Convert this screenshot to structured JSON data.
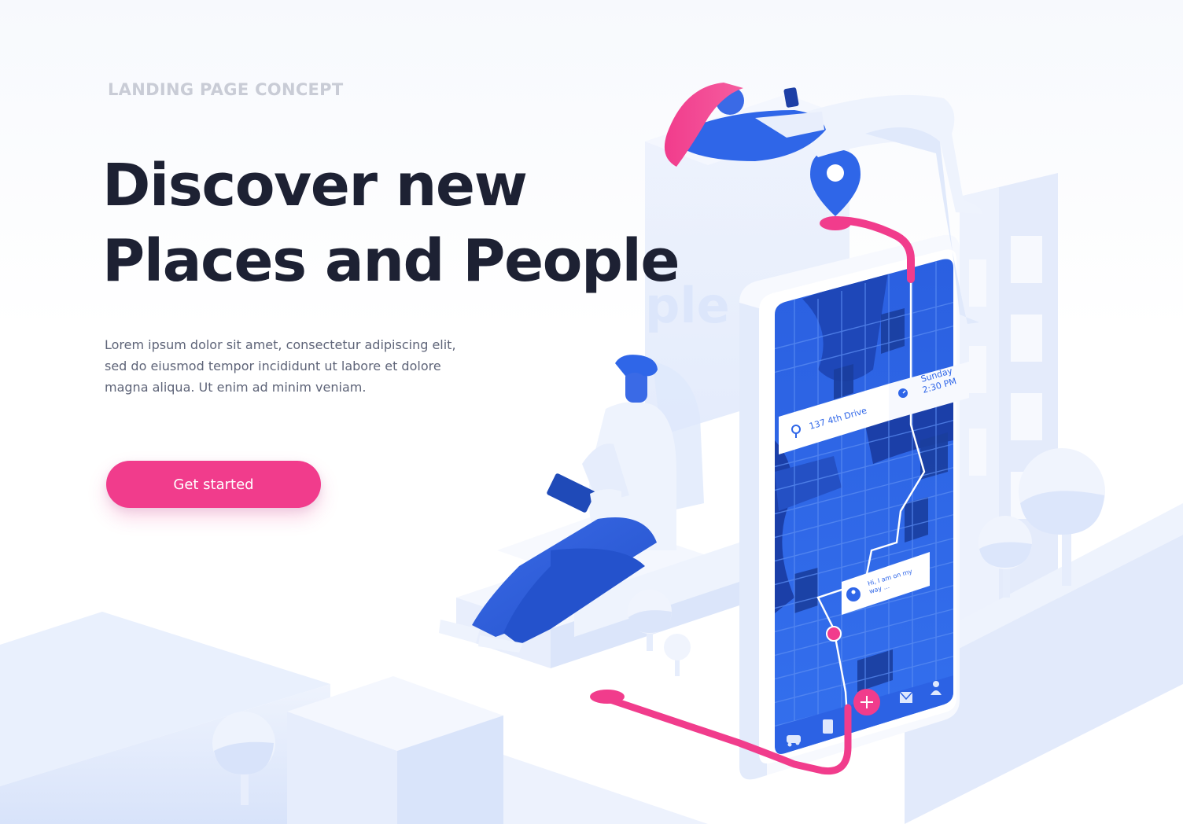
{
  "hero": {
    "eyebrow": "LANDING PAGE CONCEPT",
    "headline_line1": "Discover new",
    "headline_line2": "Places and People",
    "body_line1": "Lorem ipsum dolor sit amet, consectetur adipiscing elit,",
    "body_line2": "sed do eiusmod tempor incididunt ut labore et dolore",
    "body_line3": "magna aliqua. Ut enim ad minim veniam.",
    "cta_label": "Get started"
  },
  "phone": {
    "address": "137 4th Drive",
    "day": "Sunday",
    "time": "2:30 PM",
    "message_line1": "Hi, I am on my",
    "message_line2": "way ...",
    "nav_icons": [
      "car-icon",
      "bus-icon",
      "plus-icon",
      "mail-icon",
      "user-icon"
    ]
  },
  "building_text": "ple",
  "colors": {
    "accent": "#f13c8c",
    "primary_blue": "#2f66e8",
    "headline": "#1d2133",
    "eyebrow": "#c9ccd6",
    "body": "#5e6478"
  }
}
